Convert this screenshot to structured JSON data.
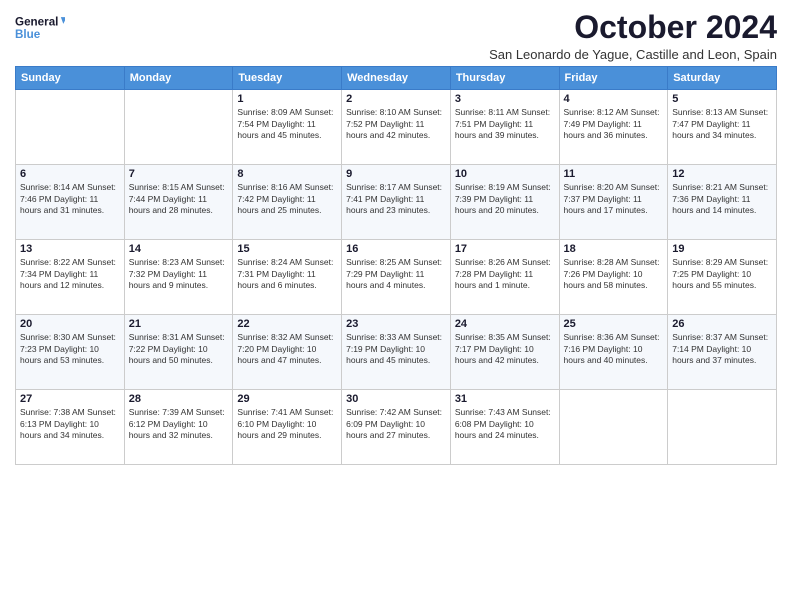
{
  "logo": {
    "line1": "General",
    "line2": "Blue"
  },
  "title": "October 2024",
  "location": "San Leonardo de Yague, Castille and Leon, Spain",
  "weekdays": [
    "Sunday",
    "Monday",
    "Tuesday",
    "Wednesday",
    "Thursday",
    "Friday",
    "Saturday"
  ],
  "weeks": [
    [
      {
        "day": "",
        "info": ""
      },
      {
        "day": "",
        "info": ""
      },
      {
        "day": "1",
        "info": "Sunrise: 8:09 AM\nSunset: 7:54 PM\nDaylight: 11 hours and 45 minutes."
      },
      {
        "day": "2",
        "info": "Sunrise: 8:10 AM\nSunset: 7:52 PM\nDaylight: 11 hours and 42 minutes."
      },
      {
        "day": "3",
        "info": "Sunrise: 8:11 AM\nSunset: 7:51 PM\nDaylight: 11 hours and 39 minutes."
      },
      {
        "day": "4",
        "info": "Sunrise: 8:12 AM\nSunset: 7:49 PM\nDaylight: 11 hours and 36 minutes."
      },
      {
        "day": "5",
        "info": "Sunrise: 8:13 AM\nSunset: 7:47 PM\nDaylight: 11 hours and 34 minutes."
      }
    ],
    [
      {
        "day": "6",
        "info": "Sunrise: 8:14 AM\nSunset: 7:46 PM\nDaylight: 11 hours and 31 minutes."
      },
      {
        "day": "7",
        "info": "Sunrise: 8:15 AM\nSunset: 7:44 PM\nDaylight: 11 hours and 28 minutes."
      },
      {
        "day": "8",
        "info": "Sunrise: 8:16 AM\nSunset: 7:42 PM\nDaylight: 11 hours and 25 minutes."
      },
      {
        "day": "9",
        "info": "Sunrise: 8:17 AM\nSunset: 7:41 PM\nDaylight: 11 hours and 23 minutes."
      },
      {
        "day": "10",
        "info": "Sunrise: 8:19 AM\nSunset: 7:39 PM\nDaylight: 11 hours and 20 minutes."
      },
      {
        "day": "11",
        "info": "Sunrise: 8:20 AM\nSunset: 7:37 PM\nDaylight: 11 hours and 17 minutes."
      },
      {
        "day": "12",
        "info": "Sunrise: 8:21 AM\nSunset: 7:36 PM\nDaylight: 11 hours and 14 minutes."
      }
    ],
    [
      {
        "day": "13",
        "info": "Sunrise: 8:22 AM\nSunset: 7:34 PM\nDaylight: 11 hours and 12 minutes."
      },
      {
        "day": "14",
        "info": "Sunrise: 8:23 AM\nSunset: 7:32 PM\nDaylight: 11 hours and 9 minutes."
      },
      {
        "day": "15",
        "info": "Sunrise: 8:24 AM\nSunset: 7:31 PM\nDaylight: 11 hours and 6 minutes."
      },
      {
        "day": "16",
        "info": "Sunrise: 8:25 AM\nSunset: 7:29 PM\nDaylight: 11 hours and 4 minutes."
      },
      {
        "day": "17",
        "info": "Sunrise: 8:26 AM\nSunset: 7:28 PM\nDaylight: 11 hours and 1 minute."
      },
      {
        "day": "18",
        "info": "Sunrise: 8:28 AM\nSunset: 7:26 PM\nDaylight: 10 hours and 58 minutes."
      },
      {
        "day": "19",
        "info": "Sunrise: 8:29 AM\nSunset: 7:25 PM\nDaylight: 10 hours and 55 minutes."
      }
    ],
    [
      {
        "day": "20",
        "info": "Sunrise: 8:30 AM\nSunset: 7:23 PM\nDaylight: 10 hours and 53 minutes."
      },
      {
        "day": "21",
        "info": "Sunrise: 8:31 AM\nSunset: 7:22 PM\nDaylight: 10 hours and 50 minutes."
      },
      {
        "day": "22",
        "info": "Sunrise: 8:32 AM\nSunset: 7:20 PM\nDaylight: 10 hours and 47 minutes."
      },
      {
        "day": "23",
        "info": "Sunrise: 8:33 AM\nSunset: 7:19 PM\nDaylight: 10 hours and 45 minutes."
      },
      {
        "day": "24",
        "info": "Sunrise: 8:35 AM\nSunset: 7:17 PM\nDaylight: 10 hours and 42 minutes."
      },
      {
        "day": "25",
        "info": "Sunrise: 8:36 AM\nSunset: 7:16 PM\nDaylight: 10 hours and 40 minutes."
      },
      {
        "day": "26",
        "info": "Sunrise: 8:37 AM\nSunset: 7:14 PM\nDaylight: 10 hours and 37 minutes."
      }
    ],
    [
      {
        "day": "27",
        "info": "Sunrise: 7:38 AM\nSunset: 6:13 PM\nDaylight: 10 hours and 34 minutes."
      },
      {
        "day": "28",
        "info": "Sunrise: 7:39 AM\nSunset: 6:12 PM\nDaylight: 10 hours and 32 minutes."
      },
      {
        "day": "29",
        "info": "Sunrise: 7:41 AM\nSunset: 6:10 PM\nDaylight: 10 hours and 29 minutes."
      },
      {
        "day": "30",
        "info": "Sunrise: 7:42 AM\nSunset: 6:09 PM\nDaylight: 10 hours and 27 minutes."
      },
      {
        "day": "31",
        "info": "Sunrise: 7:43 AM\nSunset: 6:08 PM\nDaylight: 10 hours and 24 minutes."
      },
      {
        "day": "",
        "info": ""
      },
      {
        "day": "",
        "info": ""
      }
    ]
  ]
}
